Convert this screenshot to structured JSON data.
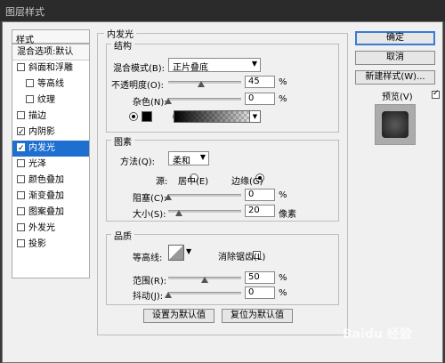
{
  "window": {
    "title": "图层样式"
  },
  "sidebar": {
    "header": "样式",
    "blending_options": "混合选项:默认",
    "items": [
      {
        "label": "斜面和浮雕",
        "checked": false
      },
      {
        "label": "等高线",
        "checked": false
      },
      {
        "label": "纹理",
        "checked": false
      },
      {
        "label": "描边",
        "checked": false
      },
      {
        "label": "内阴影",
        "checked": true
      },
      {
        "label": "内发光",
        "checked": true
      },
      {
        "label": "光泽",
        "checked": false
      },
      {
        "label": "颜色叠加",
        "checked": false
      },
      {
        "label": "渐变叠加",
        "checked": false
      },
      {
        "label": "图案叠加",
        "checked": false
      },
      {
        "label": "外发光",
        "checked": false
      },
      {
        "label": "投影",
        "checked": false
      }
    ]
  },
  "panel": {
    "title": "内发光",
    "structure": {
      "title": "结构",
      "blend_mode_label": "混合模式(B):",
      "blend_mode_value": "正片叠底",
      "opacity_label": "不透明度(O):",
      "opacity_value": "45",
      "opacity_unit": "%",
      "opacity_fraction": 0.45,
      "noise_label": "杂色(N):",
      "noise_value": "0",
      "noise_unit": "%",
      "swatch_color": "#000000"
    },
    "elements": {
      "title": "图素",
      "method_label": "方法(Q):",
      "method_value": "柔和",
      "source_label": "源:",
      "center_label": "居中(E)",
      "edge_label": "边缘(G)",
      "choke_label": "阻塞(C):",
      "choke_value": "0",
      "choke_unit": "%",
      "size_label": "大小(S):",
      "size_value": "20",
      "size_unit": "像素"
    },
    "quality": {
      "title": "品质",
      "contour_label": "等高线:",
      "antialias_label": "消除锯齿(L)",
      "range_label": "范围(R):",
      "range_value": "50",
      "range_unit": "%",
      "jitter_label": "抖动(J):",
      "jitter_value": "0",
      "jitter_unit": "%"
    },
    "set_default": "设置为默认值",
    "reset_default": "复位为默认值"
  },
  "actions": {
    "ok": "确定",
    "cancel": "取消",
    "new_style": "新建样式(W)...",
    "preview": "预览(V)"
  },
  "watermark": "Baidu 经验"
}
